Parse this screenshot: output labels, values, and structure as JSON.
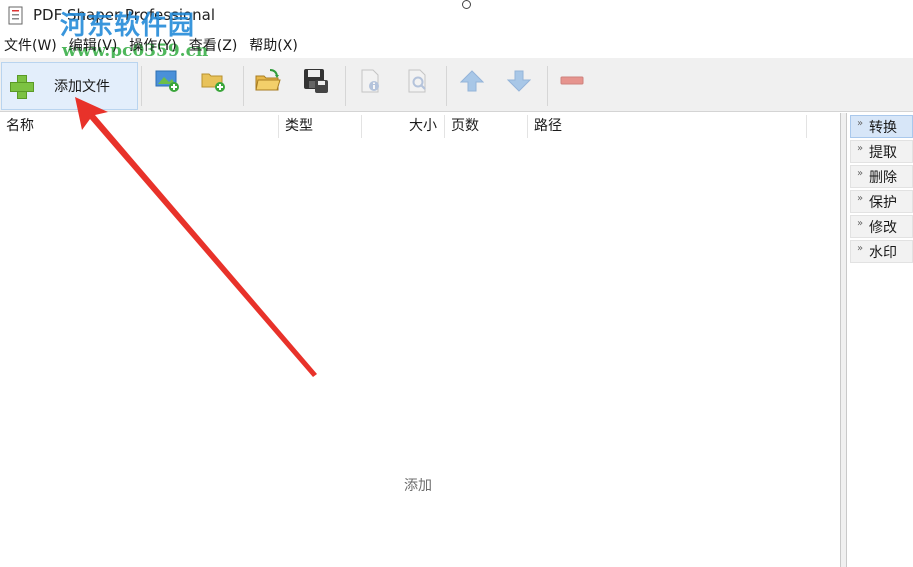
{
  "window": {
    "title": "PDF Shaper Professional"
  },
  "watermark": {
    "main": "河东软件园",
    "sub": "www.pc0359.cn"
  },
  "menu": [
    {
      "label": "文件(W)"
    },
    {
      "label": "编辑(V)"
    },
    {
      "label": "操作(Y)"
    },
    {
      "label": "查看(Z)"
    },
    {
      "label": "帮助(X)"
    }
  ],
  "toolbar": {
    "add_files_label": "添加文件",
    "icons": [
      "add-image-icon",
      "add-folder-icon",
      "open-folder-icon",
      "save-disk-icon",
      "document-info-icon",
      "document-preview-icon",
      "move-up-icon",
      "move-down-icon",
      "remove-icon"
    ]
  },
  "file_list": {
    "columns": [
      {
        "label": "名称"
      },
      {
        "label": "类型"
      },
      {
        "label": "大小"
      },
      {
        "label": "页数"
      },
      {
        "label": "路径"
      }
    ],
    "empty_hint": "添加"
  },
  "side_panel": {
    "items": [
      {
        "label": "转换",
        "active": true
      },
      {
        "label": "提取",
        "active": false
      },
      {
        "label": "删除",
        "active": false
      },
      {
        "label": "保护",
        "active": false
      },
      {
        "label": "修改",
        "active": false
      },
      {
        "label": "水印",
        "active": false
      }
    ]
  },
  "colors": {
    "accent_green": "#7cc242",
    "arrow_red": "#e8322a",
    "watermark_blue": "#1e88d8",
    "watermark_green": "#3bb04a"
  }
}
